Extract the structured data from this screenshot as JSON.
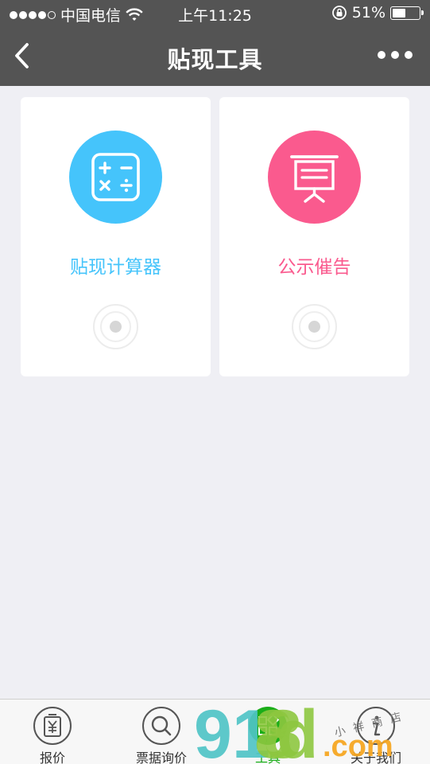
{
  "status_bar": {
    "carrier": "中国电信",
    "time": "上午11:25",
    "battery": "51%",
    "battery_level": 0.51,
    "icons": [
      "signal-dots-icon",
      "wifi-icon",
      "rotation-lock-icon",
      "battery-icon"
    ]
  },
  "nav": {
    "title": "贴现工具",
    "back_icon": "chevron-left-icon",
    "more_icon": "more-dots-icon"
  },
  "cards": [
    {
      "label": "贴现计算器",
      "icon": "calculator-icon",
      "color": "#45c4fb"
    },
    {
      "label": "公示催告",
      "icon": "notice-board-icon",
      "color": "#fa5a8e"
    }
  ],
  "tabbar": {
    "active_color": "#1aad19",
    "items": [
      {
        "label": "报价",
        "icon": "price-tag-yuan-icon"
      },
      {
        "label": "票据询价",
        "icon": "search-icon"
      },
      {
        "label": "工具",
        "icon": "grid-tools-icon"
      },
      {
        "label": "关于我们",
        "icon": "info-icon"
      }
    ]
  },
  "watermark": {
    "brand": "9188d.com",
    "chars": [
      "9",
      "1",
      "8",
      "8",
      "d",
      ".com"
    ],
    "subtitle": "小祥商店",
    "colors": [
      "#4fc3c6",
      "#8dc63f",
      "#f5a623"
    ]
  }
}
